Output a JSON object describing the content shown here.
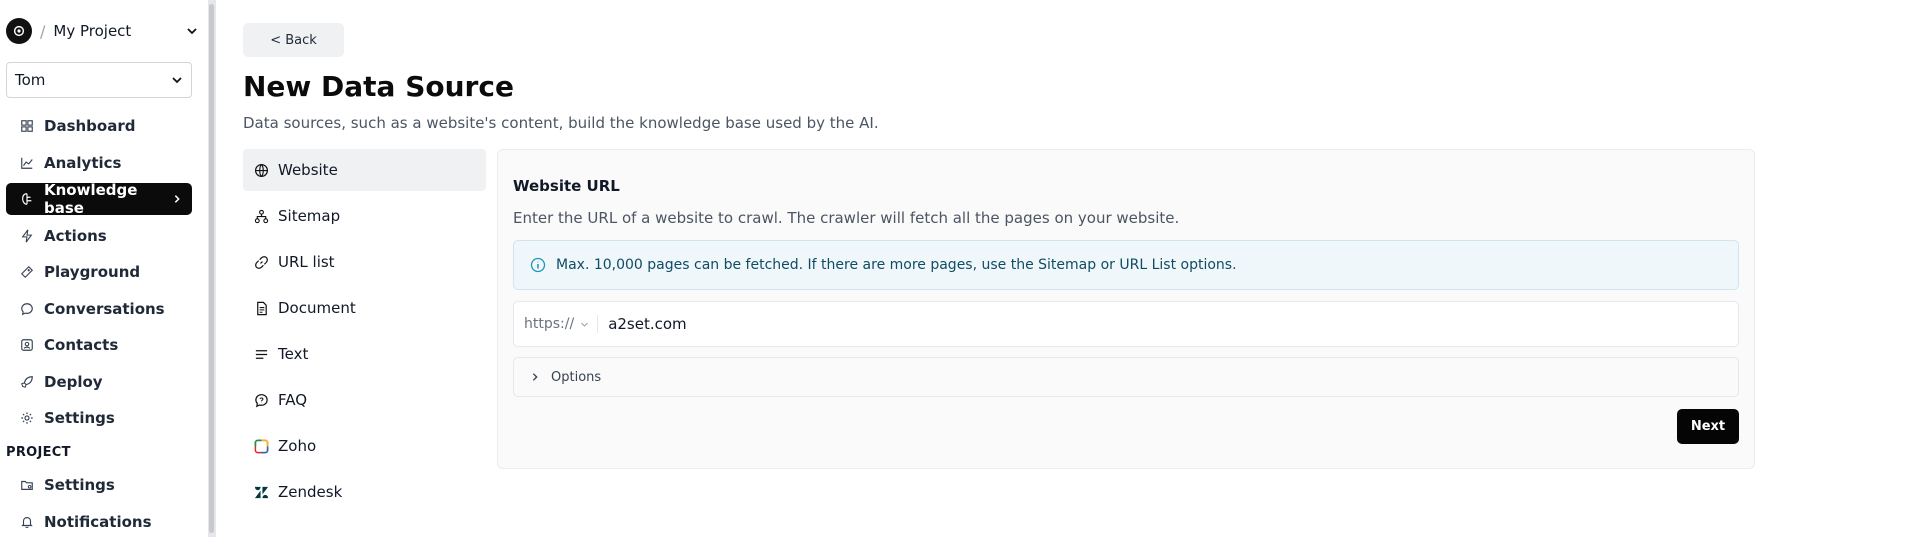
{
  "sidebar": {
    "project_name": "My Project",
    "team_name": "Tom",
    "items": [
      {
        "label": "Dashboard",
        "icon": "dashboard-icon"
      },
      {
        "label": "Analytics",
        "icon": "chart-icon"
      },
      {
        "label": "Knowledge base",
        "icon": "brain-icon",
        "active": true
      },
      {
        "label": "Actions",
        "icon": "lightning-icon"
      },
      {
        "label": "Playground",
        "icon": "gamepad-icon"
      },
      {
        "label": "Conversations",
        "icon": "chat-icon"
      },
      {
        "label": "Contacts",
        "icon": "contact-icon"
      },
      {
        "label": "Deploy",
        "icon": "rocket-icon"
      },
      {
        "label": "Settings",
        "icon": "gear-icon"
      }
    ],
    "section_label": "PROJECT",
    "project_items": [
      {
        "label": "Settings",
        "icon": "folder-gear-icon"
      },
      {
        "label": "Notifications",
        "icon": "bell-icon"
      }
    ]
  },
  "main": {
    "back_label": "< Back",
    "title": "New Data Source",
    "subtitle": "Data sources, such as a website's content, build the knowledge base used by the AI.",
    "tabs": [
      {
        "label": "Website",
        "icon": "globe-icon",
        "active": true
      },
      {
        "label": "Sitemap",
        "icon": "sitemap-icon"
      },
      {
        "label": "URL list",
        "icon": "link-icon"
      },
      {
        "label": "Document",
        "icon": "document-icon"
      },
      {
        "label": "Text",
        "icon": "text-icon"
      },
      {
        "label": "FAQ",
        "icon": "faq-icon"
      },
      {
        "label": "Zoho",
        "icon": "zoho-icon"
      },
      {
        "label": "Zendesk",
        "icon": "zendesk-icon"
      }
    ],
    "card": {
      "title": "Website URL",
      "description": "Enter the URL of a website to crawl. The crawler will fetch all the pages on your website.",
      "info": "Max. 10,000 pages can be fetched. If there are more pages, use the Sitemap or URL List options.",
      "protocol": "https://",
      "url_value": "a2set.com",
      "options_label": "Options",
      "next_label": "Next"
    }
  }
}
